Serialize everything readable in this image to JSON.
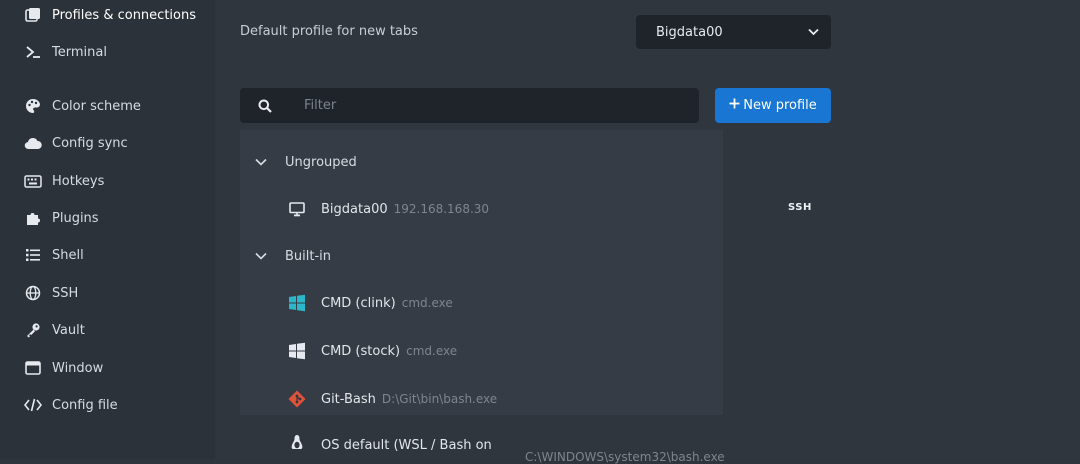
{
  "sidebar": {
    "items": [
      {
        "label": "Profiles & connections",
        "icon": "window-stack-icon"
      },
      {
        "label": "Terminal",
        "icon": "terminal-prompt-icon"
      },
      {
        "label": "Color scheme",
        "icon": "palette-icon"
      },
      {
        "label": "Config sync",
        "icon": "cloud-icon"
      },
      {
        "label": "Hotkeys",
        "icon": "keyboard-icon"
      },
      {
        "label": "Plugins",
        "icon": "puzzle-icon"
      },
      {
        "label": "Shell",
        "icon": "list-icon"
      },
      {
        "label": "SSH",
        "icon": "globe-icon"
      },
      {
        "label": "Vault",
        "icon": "key-icon"
      },
      {
        "label": "Window",
        "icon": "window-icon"
      },
      {
        "label": "Config file",
        "icon": "code-icon"
      }
    ]
  },
  "main": {
    "default_profile_label": "Default profile for new tabs",
    "default_profile_value": "Bigdata00",
    "filter_placeholder": "Filter",
    "new_profile_label": "New profile",
    "groups": [
      {
        "name": "Ungrouped",
        "profiles": [
          {
            "name": "Bigdata00",
            "detail": "192.168.168.30",
            "badge": "SSH",
            "icon": "monitor-icon"
          }
        ]
      },
      {
        "name": "Built-in",
        "profiles": [
          {
            "name": "CMD (clink)",
            "detail": "cmd.exe",
            "icon": "windows-logo-icon"
          },
          {
            "name": "CMD (stock)",
            "detail": "cmd.exe",
            "icon": "windows-logo-icon"
          },
          {
            "name": "Git-Bash",
            "detail": "D:\\Git\\bin\\bash.exe",
            "icon": "git-icon"
          },
          {
            "name": "OS default (WSL / Bash on",
            "detail": "C:\\WINDOWS\\system32\\bash.exe",
            "icon": "linux-icon"
          }
        ]
      }
    ]
  },
  "colors": {
    "accent": "#1976d2",
    "windows_logo": "#2bb6c9",
    "git": "#e0533a"
  }
}
